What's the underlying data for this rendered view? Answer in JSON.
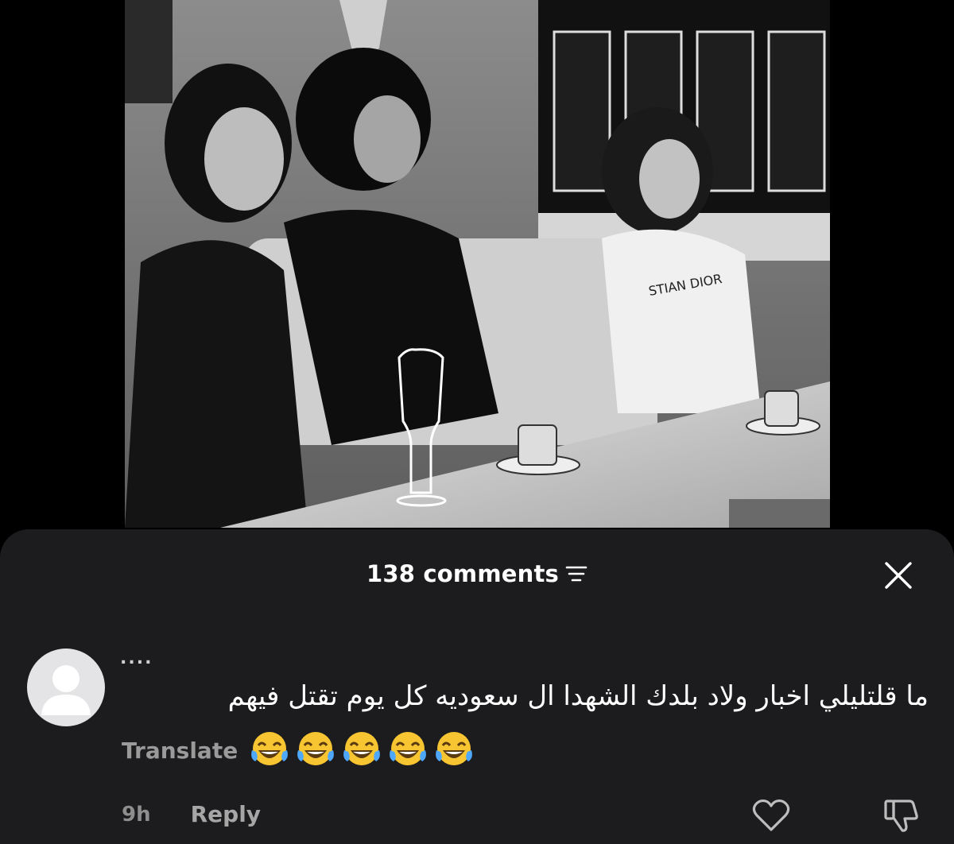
{
  "post": {
    "image_description_icon": "photo-image",
    "shirt_text": "STIAN DIOR"
  },
  "comments_sheet": {
    "count_label": "138 comments",
    "sort_icon": "filter-lines-icon",
    "close_icon": "close-x-icon"
  },
  "comment": {
    "username": "....",
    "text": "ما قلتليلي اخبار ولاد بلدك الشهدا ال سعوديه كل يوم تقتل فيهم",
    "translate_label": "Translate",
    "emoji_icon": "face-with-tears-of-joy",
    "emoji_count": 5,
    "time": "9h",
    "reply_label": "Reply",
    "like_icon": "heart-outline-icon",
    "dislike_icon": "thumbs-down-outline-icon"
  },
  "colors": {
    "background": "#000000",
    "sheet": "#1c1c1e",
    "text_primary": "#ffffff",
    "text_secondary": "#9a9a9a"
  }
}
